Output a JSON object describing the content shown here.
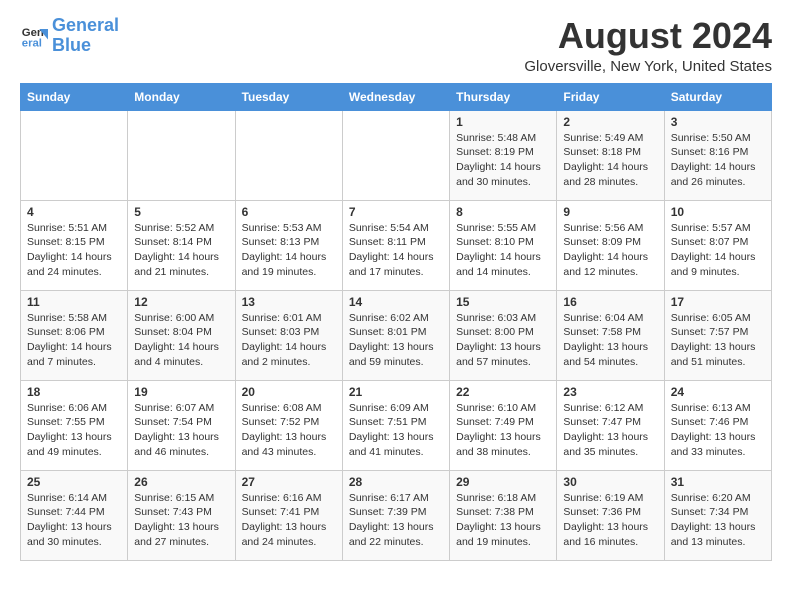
{
  "header": {
    "logo_line1": "General",
    "logo_line2": "Blue",
    "month": "August 2024",
    "location": "Gloversville, New York, United States"
  },
  "days_of_week": [
    "Sunday",
    "Monday",
    "Tuesday",
    "Wednesday",
    "Thursday",
    "Friday",
    "Saturday"
  ],
  "weeks": [
    [
      {
        "day": "",
        "info": ""
      },
      {
        "day": "",
        "info": ""
      },
      {
        "day": "",
        "info": ""
      },
      {
        "day": "",
        "info": ""
      },
      {
        "day": "1",
        "info": "Sunrise: 5:48 AM\nSunset: 8:19 PM\nDaylight: 14 hours\nand 30 minutes."
      },
      {
        "day": "2",
        "info": "Sunrise: 5:49 AM\nSunset: 8:18 PM\nDaylight: 14 hours\nand 28 minutes."
      },
      {
        "day": "3",
        "info": "Sunrise: 5:50 AM\nSunset: 8:16 PM\nDaylight: 14 hours\nand 26 minutes."
      }
    ],
    [
      {
        "day": "4",
        "info": "Sunrise: 5:51 AM\nSunset: 8:15 PM\nDaylight: 14 hours\nand 24 minutes."
      },
      {
        "day": "5",
        "info": "Sunrise: 5:52 AM\nSunset: 8:14 PM\nDaylight: 14 hours\nand 21 minutes."
      },
      {
        "day": "6",
        "info": "Sunrise: 5:53 AM\nSunset: 8:13 PM\nDaylight: 14 hours\nand 19 minutes."
      },
      {
        "day": "7",
        "info": "Sunrise: 5:54 AM\nSunset: 8:11 PM\nDaylight: 14 hours\nand 17 minutes."
      },
      {
        "day": "8",
        "info": "Sunrise: 5:55 AM\nSunset: 8:10 PM\nDaylight: 14 hours\nand 14 minutes."
      },
      {
        "day": "9",
        "info": "Sunrise: 5:56 AM\nSunset: 8:09 PM\nDaylight: 14 hours\nand 12 minutes."
      },
      {
        "day": "10",
        "info": "Sunrise: 5:57 AM\nSunset: 8:07 PM\nDaylight: 14 hours\nand 9 minutes."
      }
    ],
    [
      {
        "day": "11",
        "info": "Sunrise: 5:58 AM\nSunset: 8:06 PM\nDaylight: 14 hours\nand 7 minutes."
      },
      {
        "day": "12",
        "info": "Sunrise: 6:00 AM\nSunset: 8:04 PM\nDaylight: 14 hours\nand 4 minutes."
      },
      {
        "day": "13",
        "info": "Sunrise: 6:01 AM\nSunset: 8:03 PM\nDaylight: 14 hours\nand 2 minutes."
      },
      {
        "day": "14",
        "info": "Sunrise: 6:02 AM\nSunset: 8:01 PM\nDaylight: 13 hours\nand 59 minutes."
      },
      {
        "day": "15",
        "info": "Sunrise: 6:03 AM\nSunset: 8:00 PM\nDaylight: 13 hours\nand 57 minutes."
      },
      {
        "day": "16",
        "info": "Sunrise: 6:04 AM\nSunset: 7:58 PM\nDaylight: 13 hours\nand 54 minutes."
      },
      {
        "day": "17",
        "info": "Sunrise: 6:05 AM\nSunset: 7:57 PM\nDaylight: 13 hours\nand 51 minutes."
      }
    ],
    [
      {
        "day": "18",
        "info": "Sunrise: 6:06 AM\nSunset: 7:55 PM\nDaylight: 13 hours\nand 49 minutes."
      },
      {
        "day": "19",
        "info": "Sunrise: 6:07 AM\nSunset: 7:54 PM\nDaylight: 13 hours\nand 46 minutes."
      },
      {
        "day": "20",
        "info": "Sunrise: 6:08 AM\nSunset: 7:52 PM\nDaylight: 13 hours\nand 43 minutes."
      },
      {
        "day": "21",
        "info": "Sunrise: 6:09 AM\nSunset: 7:51 PM\nDaylight: 13 hours\nand 41 minutes."
      },
      {
        "day": "22",
        "info": "Sunrise: 6:10 AM\nSunset: 7:49 PM\nDaylight: 13 hours\nand 38 minutes."
      },
      {
        "day": "23",
        "info": "Sunrise: 6:12 AM\nSunset: 7:47 PM\nDaylight: 13 hours\nand 35 minutes."
      },
      {
        "day": "24",
        "info": "Sunrise: 6:13 AM\nSunset: 7:46 PM\nDaylight: 13 hours\nand 33 minutes."
      }
    ],
    [
      {
        "day": "25",
        "info": "Sunrise: 6:14 AM\nSunset: 7:44 PM\nDaylight: 13 hours\nand 30 minutes."
      },
      {
        "day": "26",
        "info": "Sunrise: 6:15 AM\nSunset: 7:43 PM\nDaylight: 13 hours\nand 27 minutes."
      },
      {
        "day": "27",
        "info": "Sunrise: 6:16 AM\nSunset: 7:41 PM\nDaylight: 13 hours\nand 24 minutes."
      },
      {
        "day": "28",
        "info": "Sunrise: 6:17 AM\nSunset: 7:39 PM\nDaylight: 13 hours\nand 22 minutes."
      },
      {
        "day": "29",
        "info": "Sunrise: 6:18 AM\nSunset: 7:38 PM\nDaylight: 13 hours\nand 19 minutes."
      },
      {
        "day": "30",
        "info": "Sunrise: 6:19 AM\nSunset: 7:36 PM\nDaylight: 13 hours\nand 16 minutes."
      },
      {
        "day": "31",
        "info": "Sunrise: 6:20 AM\nSunset: 7:34 PM\nDaylight: 13 hours\nand 13 minutes."
      }
    ]
  ]
}
